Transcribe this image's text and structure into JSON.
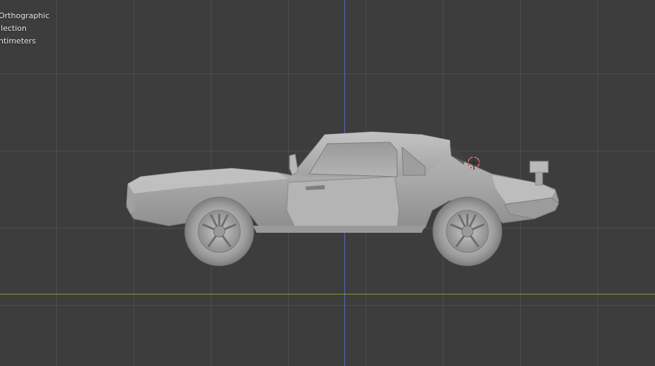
{
  "viewport": {
    "overlay": {
      "view_name": "Orthographic",
      "collection": "llection",
      "units": "ntimeters"
    },
    "object": "car-model",
    "colors": {
      "background": "#3d3d3d",
      "grid_major": "#505050",
      "grid_minor": "#3c3c3c",
      "axis_z": "#5a6fd0",
      "axis_y": "#8a9a3a",
      "origin_cursor": "#c94a4a"
    }
  }
}
